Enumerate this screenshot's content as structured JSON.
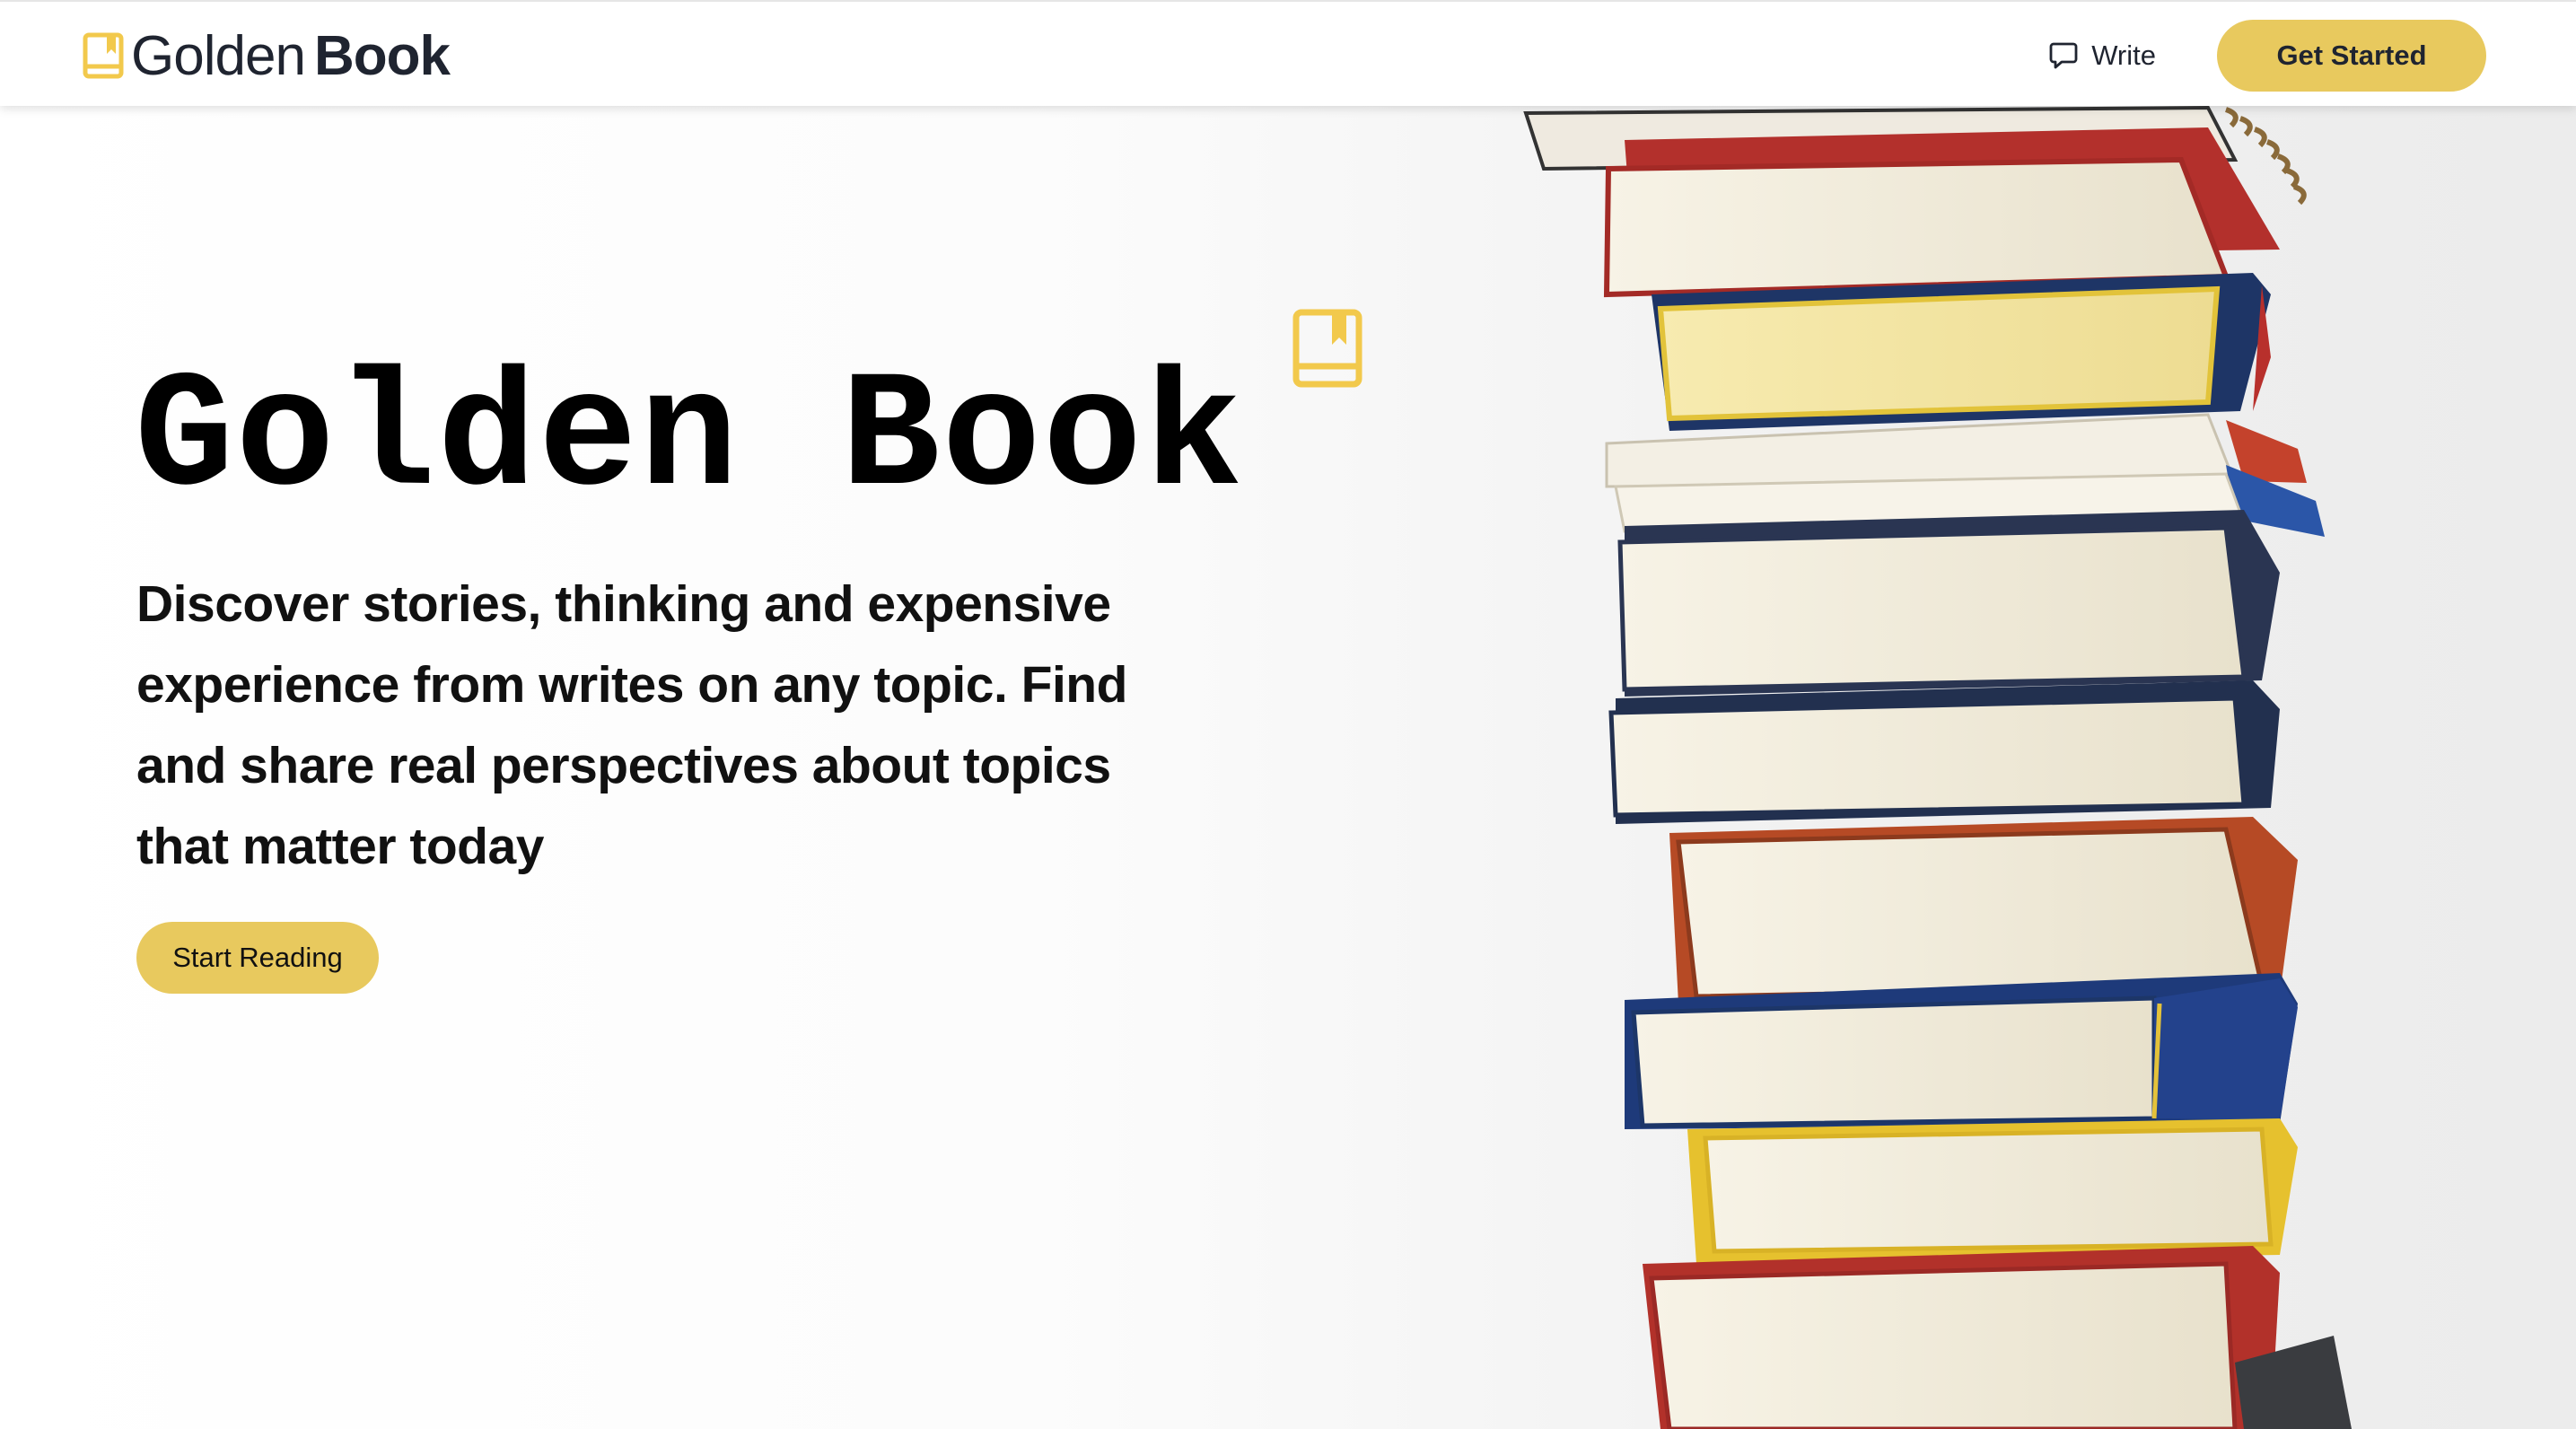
{
  "header": {
    "brand_light": "Golden",
    "brand_bold": "Book",
    "write_label": "Write",
    "get_started_label": "Get Started"
  },
  "hero": {
    "title": "Golden Book",
    "description": "Discover stories, thinking and expensive experience from writes on any topic. Find and share real perspectives about topics that matter today",
    "cta_label": "Start Reading"
  },
  "colors": {
    "accent": "#e8c95e",
    "logo": "#f2c94c",
    "text": "#1f2430"
  },
  "icons": {
    "brand": "book-bookmark-icon",
    "write": "chat-bubble-icon",
    "hero": "book-bookmark-icon"
  }
}
